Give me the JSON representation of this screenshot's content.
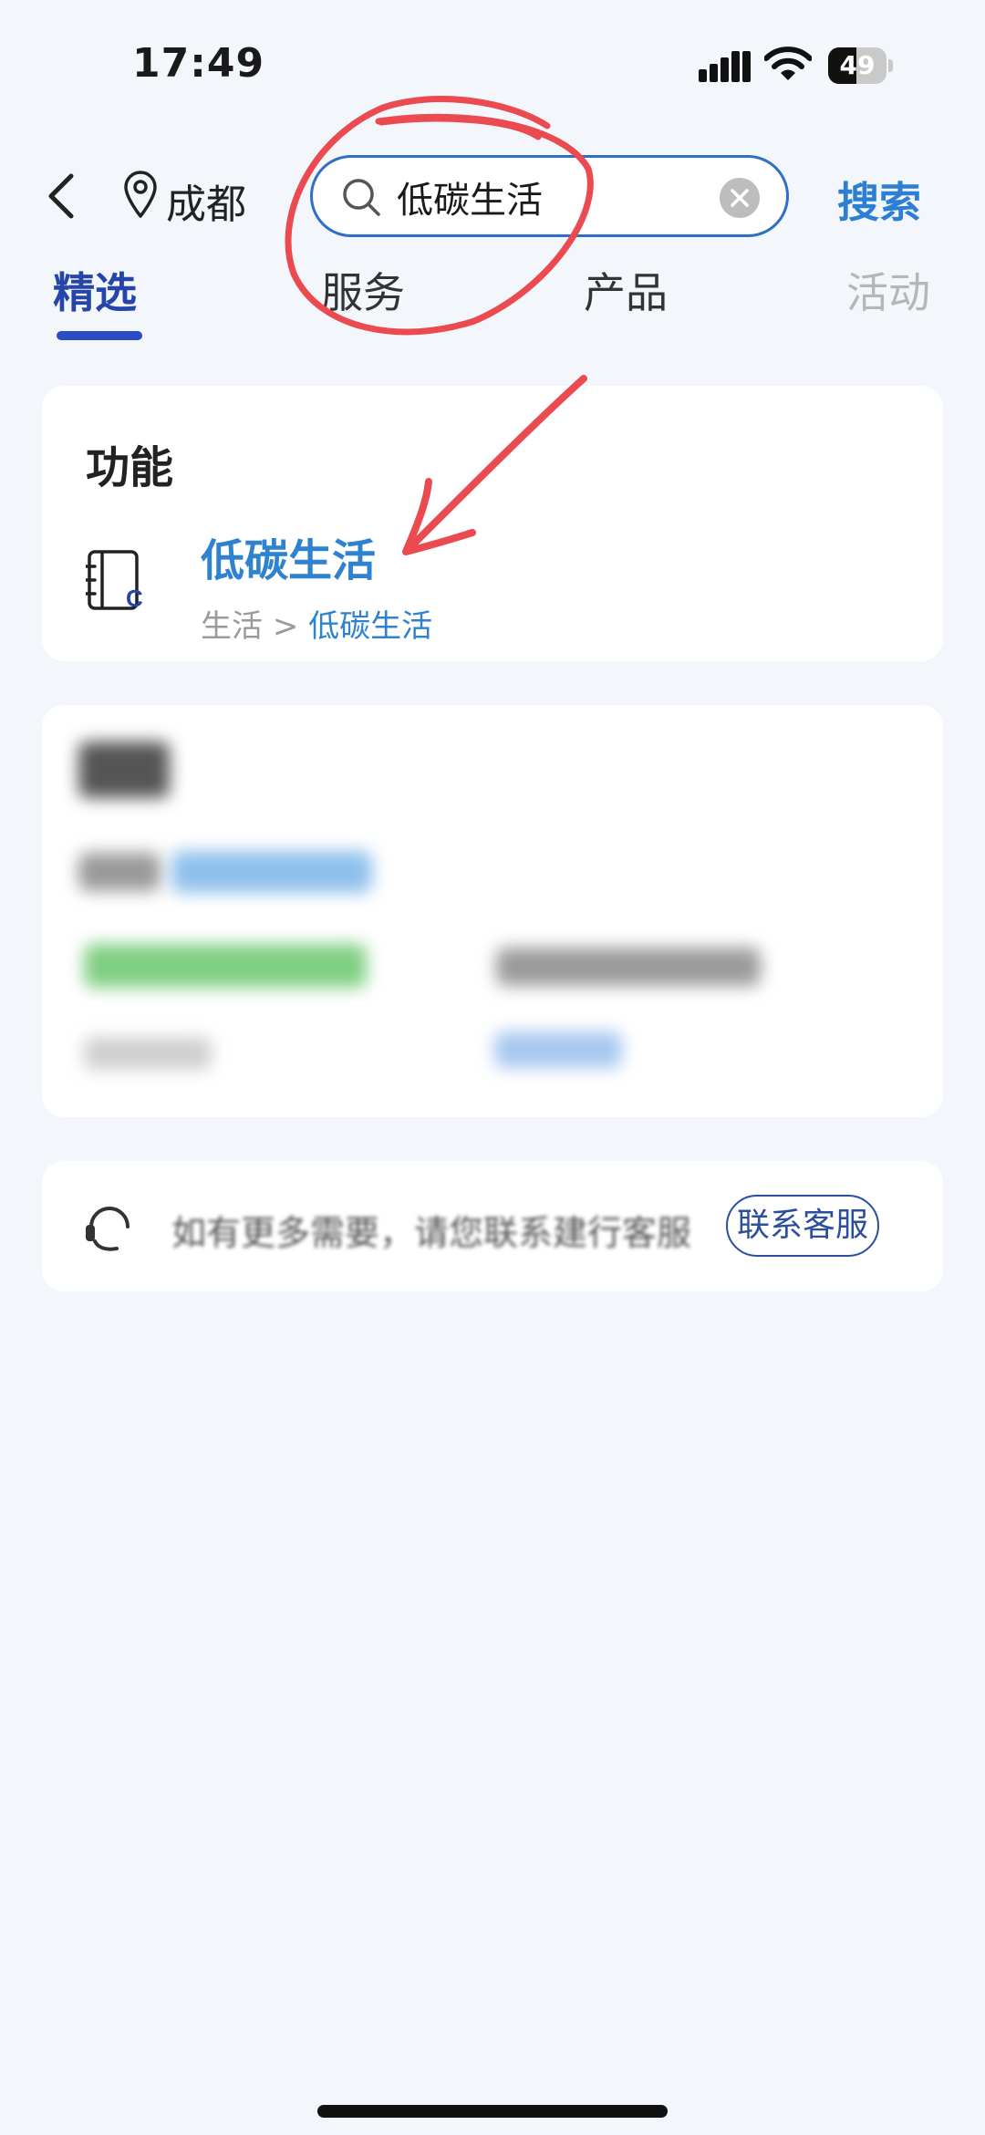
{
  "status_bar": {
    "time": "17:49",
    "battery_level": "49",
    "battery_fraction": 0.49
  },
  "header": {
    "city": "成都",
    "search": {
      "value": "低碳生活",
      "action_label": "搜索"
    }
  },
  "tabs": [
    {
      "label": "精选",
      "state": "active"
    },
    {
      "label": "服务",
      "state": "normal"
    },
    {
      "label": "产品",
      "state": "normal"
    },
    {
      "label": "活动",
      "state": "faded"
    }
  ],
  "function_card": {
    "title": "功能",
    "result": {
      "title": "低碳生活",
      "breadcrumb_parent": "生活",
      "breadcrumb_separator": ">",
      "breadcrumb_current": "低碳生活",
      "icon_letter": "C"
    }
  },
  "support_card": {
    "text": "如有更多需要，请您联系建行客服",
    "button_label": "联系客服"
  },
  "colors": {
    "accent_blue": "#2d7fd3",
    "tab_active": "#2545a8",
    "annotation_red": "#ea4a50",
    "background": "#f3f6fa"
  },
  "icons": [
    "signal-icon",
    "wifi-icon",
    "battery-icon",
    "back-icon",
    "location-pin-icon",
    "search-icon",
    "clear-icon",
    "notebook-icon",
    "headset-icon"
  ]
}
